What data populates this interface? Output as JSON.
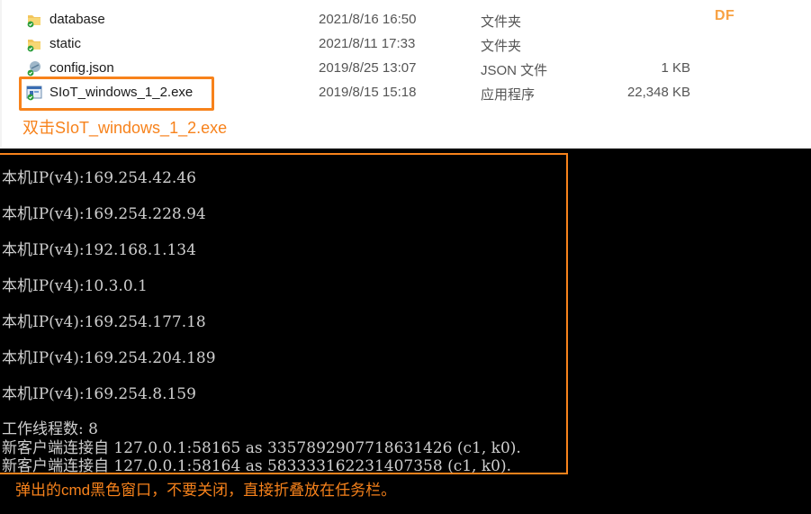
{
  "files": [
    {
      "name": "database",
      "date": "2021/8/16 16:50",
      "type": "文件夹",
      "size": "",
      "icon": "folder-icon"
    },
    {
      "name": "static",
      "date": "2021/8/11 17:33",
      "type": "文件夹",
      "size": "",
      "icon": "folder-icon"
    },
    {
      "name": "config.json",
      "date": "2019/8/25 13:07",
      "type": "JSON 文件",
      "size": "1 KB",
      "icon": "json-file-icon"
    },
    {
      "name": "SIoT_windows_1_2.exe",
      "date": "2019/8/15 15:18",
      "type": "应用程序",
      "size": "22,348 KB",
      "icon": "exe-file-icon"
    }
  ],
  "annotation_top": "双击SIoT_windows_1_2.exe",
  "logo_text": "DF",
  "console": {
    "lines": [
      "本机IP(v4):169.254.42.46",
      "本机IP(v4):169.254.228.94",
      "本机IP(v4):192.168.1.134",
      "本机IP(v4):10.3.0.1",
      "本机IP(v4):169.254.177.18",
      "本机IP(v4):169.254.204.189",
      "本机IP(v4):169.254.8.159",
      "工作线程数: 8",
      "新客户端连接自 127.0.0.1:58165 as 3357892907718631426 (c1, k0).",
      "新客户端连接自 127.0.0.1:58164 as 583333162231407358 (c1, k0)."
    ]
  },
  "annotation_bottom": "弹出的cmd黑色窗口，不要关闭，直接折叠放在任务栏。",
  "colors": {
    "accent": "#f7821b",
    "console_bg": "#000000",
    "console_text": "#cfcfcf"
  }
}
